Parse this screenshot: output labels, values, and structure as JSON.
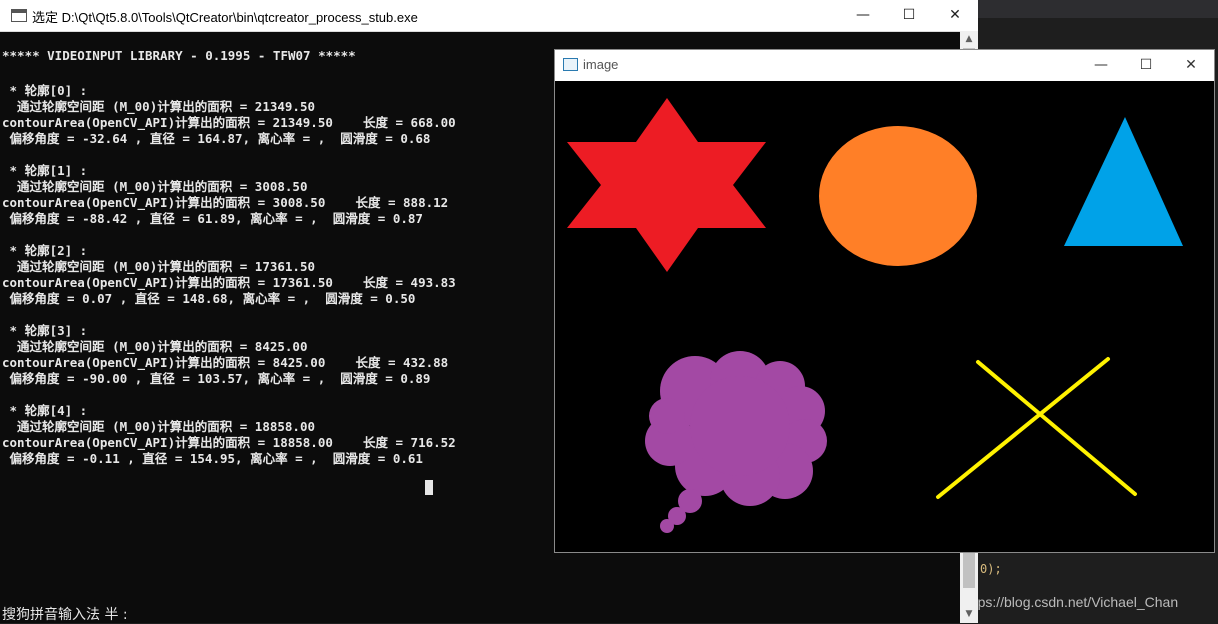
{
  "console": {
    "title": "选定 D:\\Qt\\Qt5.8.0\\Tools\\QtCreator\\bin\\qtcreator_process_stub.exe",
    "lines": [
      "***** VIDEOINPUT LIBRARY - 0.1995 - TFW07 *****",
      " * 轮廓[0] :",
      "  通过轮廓空间距 (M_00)计算出的面积 = 21349.50",
      "contourArea(OpenCV_API)计算出的面积 = 21349.50    长度 = 668.00",
      " 偏移角度 = -32.64 , 直径 = 164.87, 离心率 = ,  圆滑度 = 0.68",
      " * 轮廓[1] :",
      "  通过轮廓空间距 (M_00)计算出的面积 = 3008.50",
      "contourArea(OpenCV_API)计算出的面积 = 3008.50    长度 = 888.12",
      " 偏移角度 = -88.42 , 直径 = 61.89, 离心率 = ,  圆滑度 = 0.87",
      " * 轮廓[2] :",
      "  通过轮廓空间距 (M_00)计算出的面积 = 17361.50",
      "contourArea(OpenCV_API)计算出的面积 = 17361.50    长度 = 493.83",
      " 偏移角度 = 0.07 , 直径 = 148.68, 离心率 = ,  圆滑度 = 0.50",
      " * 轮廓[3] :",
      "  通过轮廓空间距 (M_00)计算出的面积 = 8425.00",
      "contourArea(OpenCV_API)计算出的面积 = 8425.00    长度 = 432.88",
      " 偏移角度 = -90.00 , 直径 = 103.57, 离心率 = ,  圆滑度 = 0.89",
      " * 轮廓[4] :",
      "  通过轮廓空间距 (M_00)计算出的面积 = 18858.00",
      "contourArea(OpenCV_API)计算出的面积 = 18858.00    长度 = 716.52",
      " 偏移角度 = -0.11 , 直径 = 154.95, 离心率 = ,  圆滑度 = 0.61"
    ],
    "ime_status": "搜狗拼音输入法 半 :"
  },
  "image_window": {
    "title": "image",
    "shapes": [
      {
        "name": "star-shape",
        "color": "#ed1c24"
      },
      {
        "name": "ellipse-shape",
        "color": "#ff7f27"
      },
      {
        "name": "triangle-shape",
        "color": "#00a2e8"
      },
      {
        "name": "cloud-shape",
        "color": "#a349a4"
      },
      {
        "name": "cross-shape",
        "color": "#fff200"
      }
    ]
  },
  "background": {
    "code_fragment": "0);",
    "watermark": "https://blog.csdn.net/Vichael_Chan"
  },
  "window_controls": {
    "minimize": "—",
    "maximize": "☐",
    "close": "✕"
  }
}
